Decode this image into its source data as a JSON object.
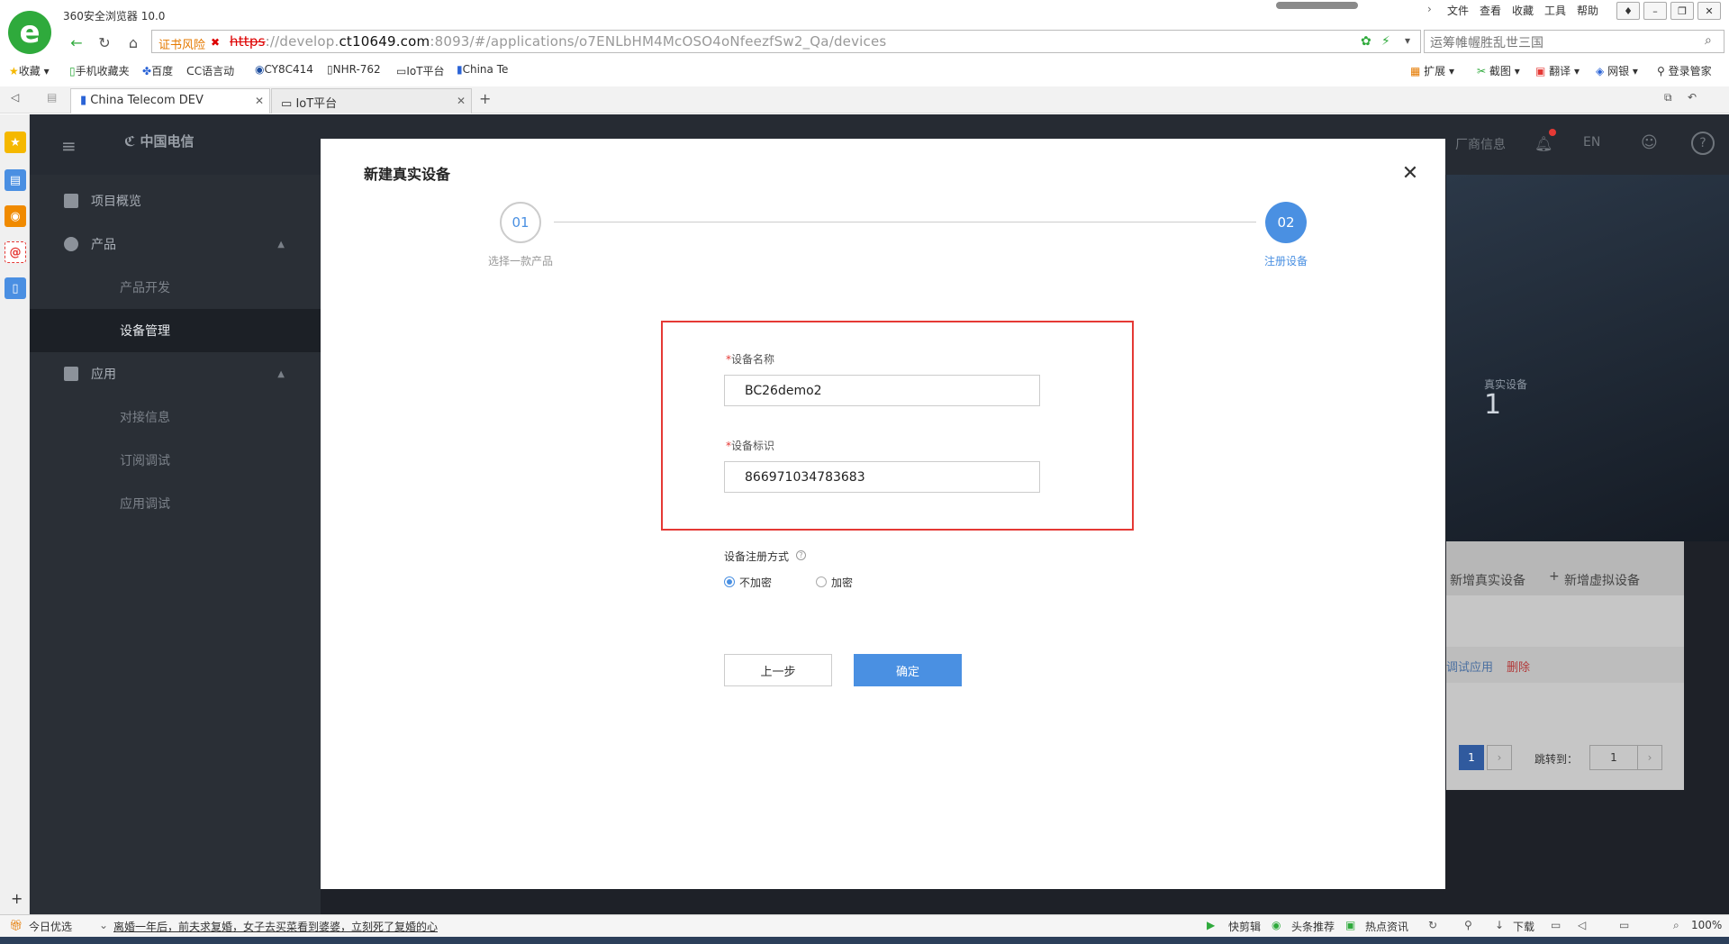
{
  "browser": {
    "app_title": "360安全浏览器 10.0",
    "menu": [
      "文件",
      "查看",
      "收藏",
      "工具",
      "帮助"
    ],
    "cert_warning": "证书风险",
    "url_https": "https",
    "url_pre": "://develop.",
    "url_host": "ct10649.com",
    "url_rest": ":8093/#/applications/o7ENLbHM4McOSO4oNfeezfSw2_Qa/devices",
    "search_text": "运筹帷幄胜乱世三国",
    "bookmarks": [
      "收藏",
      "手机收藏夹",
      "百度",
      "C语言动",
      "CY8C414",
      "NHR-762",
      "IoT平台",
      "China Te"
    ],
    "toolbar_right": [
      "扩展",
      "截图",
      "翻译",
      "网银",
      "登录管家"
    ],
    "tabs": [
      {
        "label": "China Telecom DEV"
      },
      {
        "label": "IoT平台"
      }
    ]
  },
  "app": {
    "brand": "中国电信",
    "sidebar": [
      {
        "label": "项目概览"
      },
      {
        "label": "产品"
      },
      {
        "label": "产品开发"
      },
      {
        "label": "设备管理"
      },
      {
        "label": "应用"
      },
      {
        "label": "对接信息"
      },
      {
        "label": "订阅调试"
      },
      {
        "label": "应用调试"
      }
    ],
    "topnav_right": [
      "厂商信息",
      "EN"
    ],
    "real_device_label": "真实设备",
    "real_device_count": "1",
    "add_real": "新增真实设备",
    "add_virtual": "新增虚拟设备",
    "row_actions": [
      "调试应用",
      "删除"
    ],
    "page_current": "1",
    "jump_label": "跳转到：",
    "jump_value": "1"
  },
  "modal": {
    "title": "新建真实设备",
    "step1_num": "01",
    "step1_label": "选择一款产品",
    "step2_num": "02",
    "step2_label": "注册设备",
    "name_label": "设备名称",
    "name_value": "BC26demo2",
    "id_label": "设备标识",
    "id_value": "866971034783683",
    "reg_label": "设备注册方式",
    "radio_plain": "不加密",
    "radio_encrypt": "加密",
    "btn_prev": "上一步",
    "btn_ok": "确定"
  },
  "status": {
    "today": "今日优选",
    "news": "离婚一年后，前夫求复婚，女子去买菜看到婆婆，立刻死了复婚的心",
    "right": [
      "快剪辑",
      "头条推荐",
      "热点资讯",
      "下载",
      "100%"
    ]
  },
  "colors": {
    "accent": "#4a90e2",
    "danger": "#e53935",
    "browser_green": "#2faa3c"
  }
}
